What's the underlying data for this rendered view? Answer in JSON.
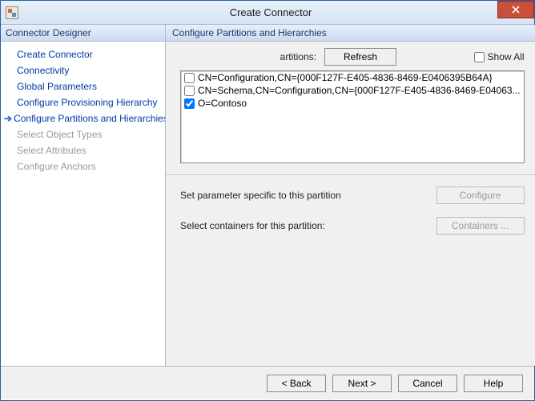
{
  "window": {
    "title": "Create Connector"
  },
  "sidebar": {
    "header": "Connector Designer",
    "items": [
      {
        "label": "Create Connector",
        "state": "done"
      },
      {
        "label": "Connectivity",
        "state": "done"
      },
      {
        "label": "Global Parameters",
        "state": "done"
      },
      {
        "label": "Configure Provisioning Hierarchy",
        "state": "done"
      },
      {
        "label": "Configure Partitions and Hierarchies",
        "state": "current"
      },
      {
        "label": "Select Object Types",
        "state": "future"
      },
      {
        "label": "Select Attributes",
        "state": "future"
      },
      {
        "label": "Configure Anchors",
        "state": "future"
      }
    ]
  },
  "main": {
    "header": "Configure Partitions and Hierarchies",
    "top": {
      "partitions_label": "artitions:",
      "refresh_label": "Refresh",
      "showall_label": "Show All",
      "showall_checked": false
    },
    "list": [
      {
        "checked": false,
        "text": "CN=Configuration,CN={000F127F-E405-4836-8469-E0406395B64A}"
      },
      {
        "checked": false,
        "text": "CN=Schema,CN=Configuration,CN={000F127F-E405-4836-8469-E04063..."
      },
      {
        "checked": true,
        "text": "O=Contoso"
      }
    ],
    "params": {
      "specific_label": "Set parameter specific to this partition",
      "configure_label": "Configure",
      "containers_text": "Select containers for this partition:",
      "containers_label": "Containers ..."
    }
  },
  "footer": {
    "back": "<  Back",
    "next": "Next  >",
    "cancel": "Cancel",
    "help": "Help"
  }
}
